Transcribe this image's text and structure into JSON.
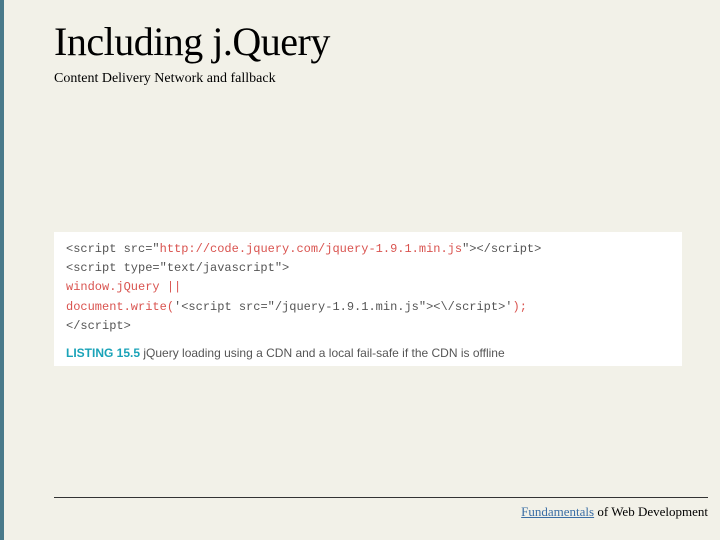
{
  "header": {
    "title": "Including j.Query",
    "subtitle": "Content Delivery Network and fallback"
  },
  "code": {
    "line1_open": "<script src=\"",
    "line1_url": "http://code.jquery.com/jquery-1.9.1.min.js",
    "line1_close": "\"></script>",
    "line2": "<script type=\"text/javascript\">",
    "line3": "window.jQuery ||",
    "line4_pre": "document.write(",
    "line4_mid": "'<script src=\"/jquery-1.9.1.min.js\"><\\/script>'",
    "line4_post": ");",
    "line5": "</script>"
  },
  "caption": {
    "label": "LISTING 15.5",
    "text": " jQuery loading using a CDN and a local fail-safe if the CDN is offline"
  },
  "footer": {
    "brand": "Fundamentals",
    "rest": " of Web Development"
  }
}
